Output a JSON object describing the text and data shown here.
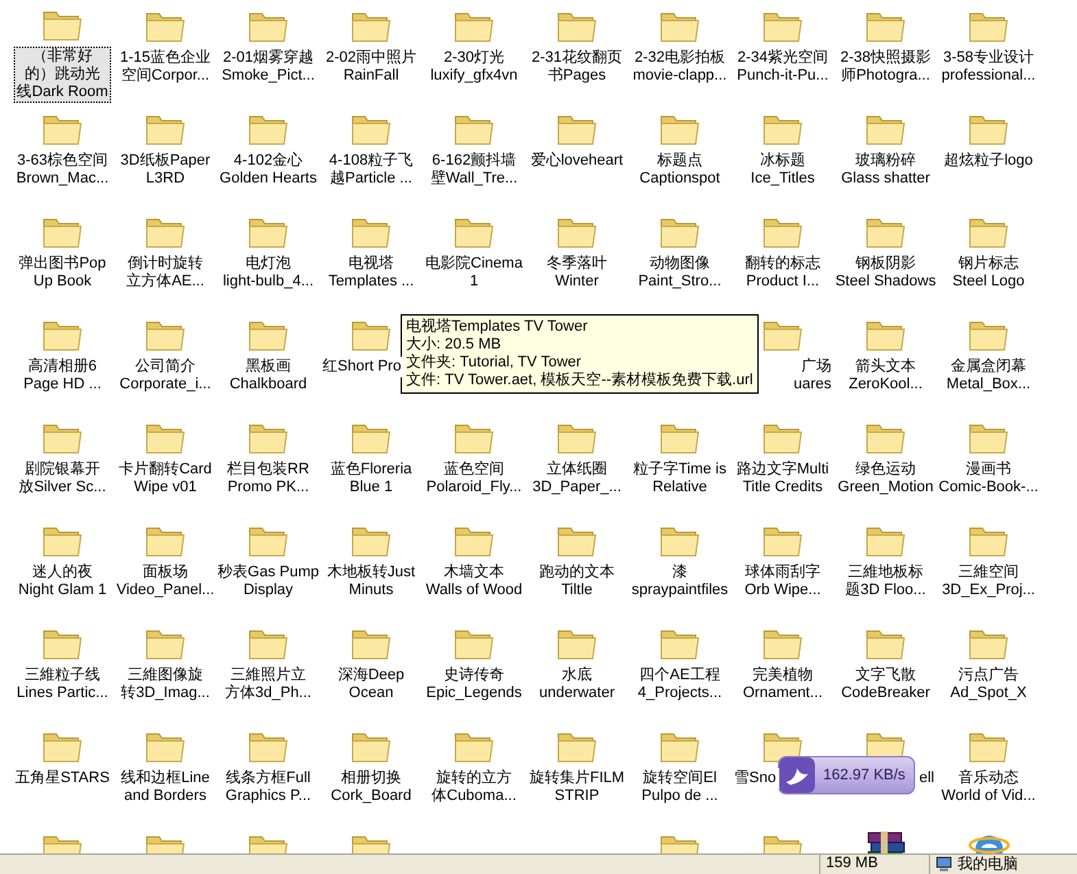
{
  "rows": [
    [
      {
        "kind": "folder",
        "selected": true,
        "lines": [
          "（非常好",
          "的）跳动光",
          "线Dark Room"
        ]
      },
      {
        "kind": "folder",
        "selected": false,
        "lines": [
          "1-15蓝色企业",
          "空间Corpor..."
        ]
      },
      {
        "kind": "folder",
        "selected": false,
        "lines": [
          "2-01烟雾穿越",
          "Smoke_Pict..."
        ]
      },
      {
        "kind": "folder",
        "selected": false,
        "lines": [
          "2-02雨中照片",
          "RainFall"
        ]
      },
      {
        "kind": "folder",
        "selected": false,
        "lines": [
          "2-30灯光",
          "luxify_gfx4vn"
        ]
      },
      {
        "kind": "folder",
        "selected": false,
        "lines": [
          "2-31花纹翻页",
          "书Pages"
        ]
      },
      {
        "kind": "folder",
        "selected": false,
        "lines": [
          "2-32电影拍板",
          "movie-clapp..."
        ]
      },
      {
        "kind": "folder",
        "selected": false,
        "lines": [
          "2-34紫光空间",
          "Punch-it-Pu..."
        ]
      },
      {
        "kind": "folder",
        "selected": false,
        "lines": [
          "2-38快照摄影",
          "师Photogra..."
        ]
      },
      {
        "kind": "folder",
        "selected": false,
        "lines": [
          "3-58专业设计",
          "professional..."
        ]
      }
    ],
    [
      {
        "kind": "folder",
        "selected": false,
        "lines": [
          "3-63棕色空间",
          "Brown_Mac..."
        ]
      },
      {
        "kind": "folder",
        "selected": false,
        "lines": [
          "3D纸板Paper",
          "L3RD"
        ]
      },
      {
        "kind": "folder",
        "selected": false,
        "lines": [
          "4-102金心",
          "Golden Hearts"
        ]
      },
      {
        "kind": "folder",
        "selected": false,
        "lines": [
          "4-108粒子飞",
          "越Particle ..."
        ]
      },
      {
        "kind": "folder",
        "selected": false,
        "lines": [
          "6-162颤抖墙",
          "壁Wall_Tre..."
        ]
      },
      {
        "kind": "folder",
        "selected": false,
        "lines": [
          "爱心loveheart"
        ]
      },
      {
        "kind": "folder",
        "selected": false,
        "lines": [
          "标题点",
          "Captionspot"
        ]
      },
      {
        "kind": "folder",
        "selected": false,
        "lines": [
          "冰标题",
          "Ice_Titles"
        ]
      },
      {
        "kind": "folder",
        "selected": false,
        "lines": [
          "玻璃粉碎",
          "Glass shatter"
        ]
      },
      {
        "kind": "folder",
        "selected": false,
        "lines": [
          "超炫粒子logo"
        ]
      }
    ],
    [
      {
        "kind": "folder",
        "selected": false,
        "lines": [
          "弹出图书Pop",
          "Up Book"
        ]
      },
      {
        "kind": "folder",
        "selected": false,
        "lines": [
          "倒计时旋转",
          "立方体AE..."
        ]
      },
      {
        "kind": "folder",
        "selected": false,
        "lines": [
          "电灯泡",
          "light-bulb_4..."
        ]
      },
      {
        "kind": "folder",
        "selected": false,
        "lines": [
          "电视塔",
          "Templates ..."
        ]
      },
      {
        "kind": "folder",
        "selected": false,
        "lines": [
          "电影院Cinema",
          "1"
        ]
      },
      {
        "kind": "folder",
        "selected": false,
        "lines": [
          "冬季落叶",
          "Winter"
        ]
      },
      {
        "kind": "folder",
        "selected": false,
        "lines": [
          "动物图像",
          "Paint_Stro..."
        ]
      },
      {
        "kind": "folder",
        "selected": false,
        "lines": [
          "翻转的标志",
          "Product I..."
        ]
      },
      {
        "kind": "folder",
        "selected": false,
        "lines": [
          "钢板阴影",
          "Steel Shadows"
        ]
      },
      {
        "kind": "folder",
        "selected": false,
        "lines": [
          "钢片标志",
          "Steel Logo"
        ]
      }
    ],
    [
      {
        "kind": "folder",
        "selected": false,
        "lines": [
          "高清相册6",
          "Page HD ..."
        ]
      },
      {
        "kind": "folder",
        "selected": false,
        "lines": [
          "公司简介",
          "Corporate_i..."
        ]
      },
      {
        "kind": "folder",
        "selected": false,
        "lines": [
          "黑板画",
          "Chalkboard"
        ]
      },
      {
        "kind": "folder-cut-right",
        "selected": false,
        "lines": [
          "红Short Pro"
        ]
      },
      {
        "kind": "covered"
      },
      {
        "kind": "covered"
      },
      {
        "kind": "covered"
      },
      {
        "kind": "folder-cut-left",
        "selected": false,
        "lines": [
          "广场",
          "uares"
        ]
      },
      {
        "kind": "folder",
        "selected": false,
        "lines": [
          "箭头文本",
          "ZeroKool..."
        ]
      },
      {
        "kind": "folder",
        "selected": false,
        "lines": [
          "金属盒闭幕",
          "Metal_Box..."
        ]
      }
    ],
    [
      {
        "kind": "folder",
        "selected": false,
        "lines": [
          "剧院银幕开",
          "放Silver Sc..."
        ]
      },
      {
        "kind": "folder",
        "selected": false,
        "lines": [
          "卡片翻转Card",
          "Wipe v01"
        ]
      },
      {
        "kind": "folder",
        "selected": false,
        "lines": [
          "栏目包装RR",
          "Promo PK..."
        ]
      },
      {
        "kind": "folder",
        "selected": false,
        "lines": [
          "蓝色Floreria",
          "Blue 1"
        ]
      },
      {
        "kind": "folder",
        "selected": false,
        "lines": [
          "蓝色空间",
          "Polaroid_Fly..."
        ]
      },
      {
        "kind": "folder",
        "selected": false,
        "lines": [
          "立体纸圈",
          "3D_Paper_..."
        ]
      },
      {
        "kind": "folder",
        "selected": false,
        "lines": [
          "粒子字Time is",
          "Relative"
        ]
      },
      {
        "kind": "folder",
        "selected": false,
        "lines": [
          "路边文字Multi",
          "Title Credits"
        ]
      },
      {
        "kind": "folder",
        "selected": false,
        "lines": [
          "绿色运动",
          "Green_Motion"
        ]
      },
      {
        "kind": "folder",
        "selected": false,
        "lines": [
          "漫画书",
          "Comic-Book-..."
        ]
      }
    ],
    [
      {
        "kind": "folder",
        "selected": false,
        "lines": [
          "迷人的夜",
          "Night Glam 1"
        ]
      },
      {
        "kind": "folder",
        "selected": false,
        "lines": [
          "面板场",
          "Video_Panel..."
        ]
      },
      {
        "kind": "folder",
        "selected": false,
        "lines": [
          "秒表Gas Pump",
          "Display"
        ]
      },
      {
        "kind": "folder",
        "selected": false,
        "lines": [
          "木地板转Just",
          "Minuts"
        ]
      },
      {
        "kind": "folder",
        "selected": false,
        "lines": [
          "木墙文本",
          "Walls of Wood"
        ]
      },
      {
        "kind": "folder",
        "selected": false,
        "lines": [
          "跑动的文本",
          "Tiltle"
        ]
      },
      {
        "kind": "folder",
        "selected": false,
        "lines": [
          "漆",
          "spraypaintfiles"
        ]
      },
      {
        "kind": "folder",
        "selected": false,
        "lines": [
          "球体雨刮字",
          "Orb Wipe..."
        ]
      },
      {
        "kind": "folder",
        "selected": false,
        "lines": [
          "三維地板标",
          "题3D Floo..."
        ]
      },
      {
        "kind": "folder",
        "selected": false,
        "lines": [
          "三維空间",
          "3D_Ex_Proj..."
        ]
      }
    ],
    [
      {
        "kind": "folder",
        "selected": false,
        "lines": [
          "三維粒子线",
          "Lines Partic..."
        ]
      },
      {
        "kind": "folder",
        "selected": false,
        "lines": [
          "三維图像旋",
          "转3D_Imag..."
        ]
      },
      {
        "kind": "folder",
        "selected": false,
        "lines": [
          "三維照片立",
          "方体3d_Ph..."
        ]
      },
      {
        "kind": "folder",
        "selected": false,
        "lines": [
          "深海Deep",
          "Ocean"
        ]
      },
      {
        "kind": "folder",
        "selected": false,
        "lines": [
          "史诗传奇",
          "Epic_Legends"
        ]
      },
      {
        "kind": "folder",
        "selected": false,
        "lines": [
          "水底",
          "underwater"
        ]
      },
      {
        "kind": "folder",
        "selected": false,
        "lines": [
          "四个AE工程",
          "4_Projects..."
        ]
      },
      {
        "kind": "folder",
        "selected": false,
        "lines": [
          "完美植物",
          "Ornament..."
        ]
      },
      {
        "kind": "folder",
        "selected": false,
        "lines": [
          "文字飞散",
          "CodeBreaker"
        ]
      },
      {
        "kind": "folder",
        "selected": false,
        "lines": [
          "污点广告",
          "Ad_Spot_X"
        ]
      }
    ],
    [
      {
        "kind": "folder",
        "selected": false,
        "lines": [
          "五角星STARS"
        ]
      },
      {
        "kind": "folder",
        "selected": false,
        "lines": [
          "线和边框Line",
          "and Borders"
        ]
      },
      {
        "kind": "folder",
        "selected": false,
        "lines": [
          "线条方框Full",
          "Graphics P..."
        ]
      },
      {
        "kind": "folder",
        "selected": false,
        "lines": [
          "相册切换",
          "Cork_Board"
        ]
      },
      {
        "kind": "folder",
        "selected": false,
        "lines": [
          "旋转的立方",
          "体Cuboma..."
        ]
      },
      {
        "kind": "folder",
        "selected": false,
        "lines": [
          "旋转集片FILM",
          "STRIP"
        ]
      },
      {
        "kind": "folder",
        "selected": false,
        "lines": [
          "旋转空间El",
          "Pulpo de ..."
        ]
      },
      {
        "kind": "folder-cut-right",
        "selected": false,
        "lines": [
          "雪Sno"
        ]
      },
      {
        "kind": "folder-cut-left",
        "selected": false,
        "lines": [
          "ell"
        ]
      },
      {
        "kind": "folder",
        "selected": false,
        "lines": [
          "音乐动态",
          "World of Vid..."
        ]
      }
    ],
    [
      {
        "kind": "folder"
      },
      {
        "kind": "folder"
      },
      {
        "kind": "folder"
      },
      {
        "kind": "folder"
      },
      {
        "kind": "covered"
      },
      {
        "kind": "covered"
      },
      {
        "kind": "folder"
      },
      {
        "kind": "folder"
      },
      {
        "kind": "archive"
      },
      {
        "kind": "browser"
      }
    ]
  ],
  "tooltip": {
    "lines": [
      "电视塔Templates TV Tower",
      "大小: 20.5 MB",
      "文件夹: Tutorial, TV Tower",
      "文件: TV Tower.aet, 模板天空--素材模板免费下载.url"
    ]
  },
  "speed_widget": {
    "reading": "162.97 KB/s"
  },
  "status_bar": {
    "size": "159 MB",
    "location": "我的电脑"
  }
}
